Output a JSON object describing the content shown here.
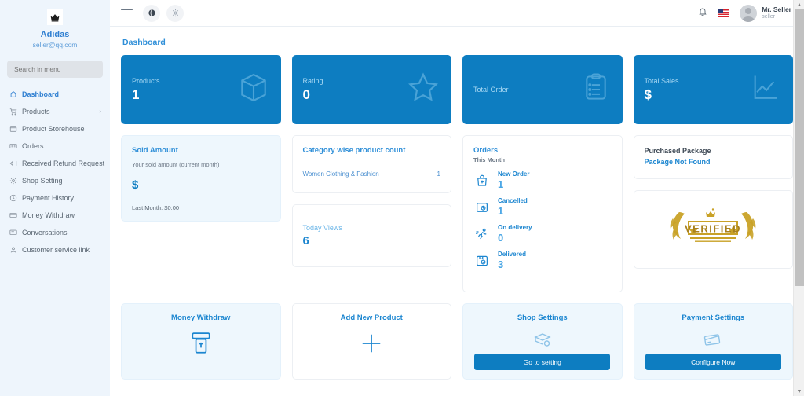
{
  "sidebar": {
    "logo_icon": "crown-icon",
    "brand_name": "Adidas",
    "brand_email": "seller@qq.com",
    "search_placeholder": "Search in menu",
    "items": [
      {
        "label": "Dashboard",
        "icon": "home-icon",
        "active": true,
        "chevron": ""
      },
      {
        "label": "Products",
        "icon": "cart-icon",
        "active": false,
        "chevron": "›"
      },
      {
        "label": "Product Storehouse",
        "icon": "box-icon",
        "active": false,
        "chevron": ""
      },
      {
        "label": "Orders",
        "icon": "list-icon",
        "active": false,
        "chevron": ""
      },
      {
        "label": "Received Refund Request",
        "icon": "refund-icon",
        "active": false,
        "chevron": ""
      },
      {
        "label": "Shop Setting",
        "icon": "gear-icon",
        "active": false,
        "chevron": ""
      },
      {
        "label": "Payment History",
        "icon": "clock-icon",
        "active": false,
        "chevron": ""
      },
      {
        "label": "Money Withdraw",
        "icon": "card-icon",
        "active": false,
        "chevron": ""
      },
      {
        "label": "Conversations",
        "icon": "chat-icon",
        "active": false,
        "chevron": ""
      },
      {
        "label": "Customer service link",
        "icon": "user-icon",
        "active": false,
        "chevron": ""
      }
    ]
  },
  "topbar": {
    "menu_icon": "hamburger-icon",
    "globe_icon": "globe-icon",
    "settings_icon": "gear-icon",
    "bell_icon": "bell-icon",
    "flag_icon": "us-flag-icon",
    "user_name": "Mr. Seller",
    "user_role": "seller"
  },
  "page": {
    "title": "Dashboard"
  },
  "stats": [
    {
      "label": "Products",
      "value": "1",
      "icon": "box-icon"
    },
    {
      "label": "Rating",
      "value": "0",
      "icon": "star-icon"
    },
    {
      "label": "Total Order",
      "value": "",
      "icon": "clipboard-list-icon"
    },
    {
      "label": "Total Sales",
      "value": "$",
      "icon": "line-chart-icon"
    }
  ],
  "sold_amount": {
    "title": "Sold Amount",
    "subtitle": "Your sold amount (current month)",
    "value": "$",
    "last_month": "Last Month: $0.00"
  },
  "category_count": {
    "title": "Category wise product count",
    "rows": [
      {
        "name": "Women Clothing & Fashion",
        "count": "1"
      }
    ]
  },
  "today_views": {
    "label": "Today Views",
    "value": "6"
  },
  "orders": {
    "title": "Orders",
    "subtitle": "This Month",
    "items": [
      {
        "label": "New Order",
        "value": "1",
        "icon": "bag-plus-icon"
      },
      {
        "label": "Cancelled",
        "value": "1",
        "icon": "box-cancel-icon"
      },
      {
        "label": "On delivery",
        "value": "0",
        "icon": "runner-icon"
      },
      {
        "label": "Delivered",
        "value": "3",
        "icon": "box-check-icon"
      }
    ]
  },
  "purchased_package": {
    "title": "Purchased Package",
    "status": "Package Not Found"
  },
  "verified_badge": {
    "text": "VERIFIED",
    "icon": "verified-laurel-icon",
    "color": "#c9a227"
  },
  "actions": [
    {
      "title": "Money Withdraw",
      "icon": "atm-icon",
      "button": "",
      "style": "tint"
    },
    {
      "title": "Add New Product",
      "icon": "plus-icon",
      "button": "",
      "style": "plain"
    },
    {
      "title": "Shop Settings",
      "icon": "shop-gear-icon",
      "button": "Go to setting",
      "style": "tint"
    },
    {
      "title": "Payment Settings",
      "icon": "credit-card-icon",
      "button": "Configure Now",
      "style": "tint"
    }
  ],
  "colors": {
    "primary": "#0d7dc1",
    "accent": "#2f8fd8",
    "sidebar_bg": "#eef5fc",
    "card_tint": "#eef7fd",
    "gold": "#c9a227"
  },
  "scrollbar": {
    "up_arrow": "▲",
    "down_arrow": "▼"
  }
}
